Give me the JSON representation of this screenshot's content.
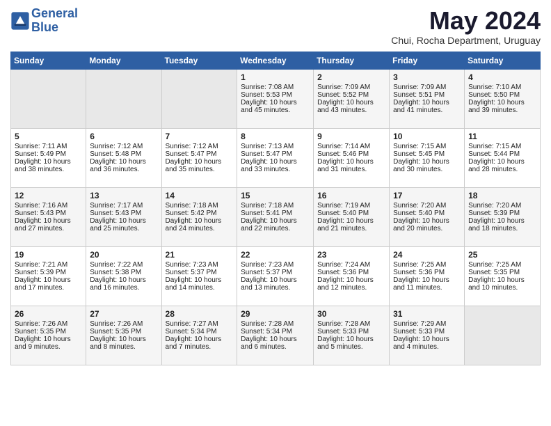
{
  "logo": {
    "line1": "General",
    "line2": "Blue"
  },
  "title": "May 2024",
  "subtitle": "Chui, Rocha Department, Uruguay",
  "days_of_week": [
    "Sunday",
    "Monday",
    "Tuesday",
    "Wednesday",
    "Thursday",
    "Friday",
    "Saturday"
  ],
  "weeks": [
    [
      {
        "day": "",
        "sunrise": "",
        "sunset": "",
        "daylight": "",
        "empty": true
      },
      {
        "day": "",
        "sunrise": "",
        "sunset": "",
        "daylight": "",
        "empty": true
      },
      {
        "day": "",
        "sunrise": "",
        "sunset": "",
        "daylight": "",
        "empty": true
      },
      {
        "day": "1",
        "sunrise": "Sunrise: 7:08 AM",
        "sunset": "Sunset: 5:53 PM",
        "daylight": "Daylight: 10 hours and 45 minutes."
      },
      {
        "day": "2",
        "sunrise": "Sunrise: 7:09 AM",
        "sunset": "Sunset: 5:52 PM",
        "daylight": "Daylight: 10 hours and 43 minutes."
      },
      {
        "day": "3",
        "sunrise": "Sunrise: 7:09 AM",
        "sunset": "Sunset: 5:51 PM",
        "daylight": "Daylight: 10 hours and 41 minutes."
      },
      {
        "day": "4",
        "sunrise": "Sunrise: 7:10 AM",
        "sunset": "Sunset: 5:50 PM",
        "daylight": "Daylight: 10 hours and 39 minutes."
      }
    ],
    [
      {
        "day": "5",
        "sunrise": "Sunrise: 7:11 AM",
        "sunset": "Sunset: 5:49 PM",
        "daylight": "Daylight: 10 hours and 38 minutes."
      },
      {
        "day": "6",
        "sunrise": "Sunrise: 7:12 AM",
        "sunset": "Sunset: 5:48 PM",
        "daylight": "Daylight: 10 hours and 36 minutes."
      },
      {
        "day": "7",
        "sunrise": "Sunrise: 7:12 AM",
        "sunset": "Sunset: 5:47 PM",
        "daylight": "Daylight: 10 hours and 35 minutes."
      },
      {
        "day": "8",
        "sunrise": "Sunrise: 7:13 AM",
        "sunset": "Sunset: 5:47 PM",
        "daylight": "Daylight: 10 hours and 33 minutes."
      },
      {
        "day": "9",
        "sunrise": "Sunrise: 7:14 AM",
        "sunset": "Sunset: 5:46 PM",
        "daylight": "Daylight: 10 hours and 31 minutes."
      },
      {
        "day": "10",
        "sunrise": "Sunrise: 7:15 AM",
        "sunset": "Sunset: 5:45 PM",
        "daylight": "Daylight: 10 hours and 30 minutes."
      },
      {
        "day": "11",
        "sunrise": "Sunrise: 7:15 AM",
        "sunset": "Sunset: 5:44 PM",
        "daylight": "Daylight: 10 hours and 28 minutes."
      }
    ],
    [
      {
        "day": "12",
        "sunrise": "Sunrise: 7:16 AM",
        "sunset": "Sunset: 5:43 PM",
        "daylight": "Daylight: 10 hours and 27 minutes."
      },
      {
        "day": "13",
        "sunrise": "Sunrise: 7:17 AM",
        "sunset": "Sunset: 5:43 PM",
        "daylight": "Daylight: 10 hours and 25 minutes."
      },
      {
        "day": "14",
        "sunrise": "Sunrise: 7:18 AM",
        "sunset": "Sunset: 5:42 PM",
        "daylight": "Daylight: 10 hours and 24 minutes."
      },
      {
        "day": "15",
        "sunrise": "Sunrise: 7:18 AM",
        "sunset": "Sunset: 5:41 PM",
        "daylight": "Daylight: 10 hours and 22 minutes."
      },
      {
        "day": "16",
        "sunrise": "Sunrise: 7:19 AM",
        "sunset": "Sunset: 5:40 PM",
        "daylight": "Daylight: 10 hours and 21 minutes."
      },
      {
        "day": "17",
        "sunrise": "Sunrise: 7:20 AM",
        "sunset": "Sunset: 5:40 PM",
        "daylight": "Daylight: 10 hours and 20 minutes."
      },
      {
        "day": "18",
        "sunrise": "Sunrise: 7:20 AM",
        "sunset": "Sunset: 5:39 PM",
        "daylight": "Daylight: 10 hours and 18 minutes."
      }
    ],
    [
      {
        "day": "19",
        "sunrise": "Sunrise: 7:21 AM",
        "sunset": "Sunset: 5:39 PM",
        "daylight": "Daylight: 10 hours and 17 minutes."
      },
      {
        "day": "20",
        "sunrise": "Sunrise: 7:22 AM",
        "sunset": "Sunset: 5:38 PM",
        "daylight": "Daylight: 10 hours and 16 minutes."
      },
      {
        "day": "21",
        "sunrise": "Sunrise: 7:23 AM",
        "sunset": "Sunset: 5:37 PM",
        "daylight": "Daylight: 10 hours and 14 minutes."
      },
      {
        "day": "22",
        "sunrise": "Sunrise: 7:23 AM",
        "sunset": "Sunset: 5:37 PM",
        "daylight": "Daylight: 10 hours and 13 minutes."
      },
      {
        "day": "23",
        "sunrise": "Sunrise: 7:24 AM",
        "sunset": "Sunset: 5:36 PM",
        "daylight": "Daylight: 10 hours and 12 minutes."
      },
      {
        "day": "24",
        "sunrise": "Sunrise: 7:25 AM",
        "sunset": "Sunset: 5:36 PM",
        "daylight": "Daylight: 10 hours and 11 minutes."
      },
      {
        "day": "25",
        "sunrise": "Sunrise: 7:25 AM",
        "sunset": "Sunset: 5:35 PM",
        "daylight": "Daylight: 10 hours and 10 minutes."
      }
    ],
    [
      {
        "day": "26",
        "sunrise": "Sunrise: 7:26 AM",
        "sunset": "Sunset: 5:35 PM",
        "daylight": "Daylight: 10 hours and 9 minutes."
      },
      {
        "day": "27",
        "sunrise": "Sunrise: 7:26 AM",
        "sunset": "Sunset: 5:35 PM",
        "daylight": "Daylight: 10 hours and 8 minutes."
      },
      {
        "day": "28",
        "sunrise": "Sunrise: 7:27 AM",
        "sunset": "Sunset: 5:34 PM",
        "daylight": "Daylight: 10 hours and 7 minutes."
      },
      {
        "day": "29",
        "sunrise": "Sunrise: 7:28 AM",
        "sunset": "Sunset: 5:34 PM",
        "daylight": "Daylight: 10 hours and 6 minutes."
      },
      {
        "day": "30",
        "sunrise": "Sunrise: 7:28 AM",
        "sunset": "Sunset: 5:33 PM",
        "daylight": "Daylight: 10 hours and 5 minutes."
      },
      {
        "day": "31",
        "sunrise": "Sunrise: 7:29 AM",
        "sunset": "Sunset: 5:33 PM",
        "daylight": "Daylight: 10 hours and 4 minutes."
      },
      {
        "day": "",
        "sunrise": "",
        "sunset": "",
        "daylight": "",
        "empty": true
      }
    ]
  ]
}
